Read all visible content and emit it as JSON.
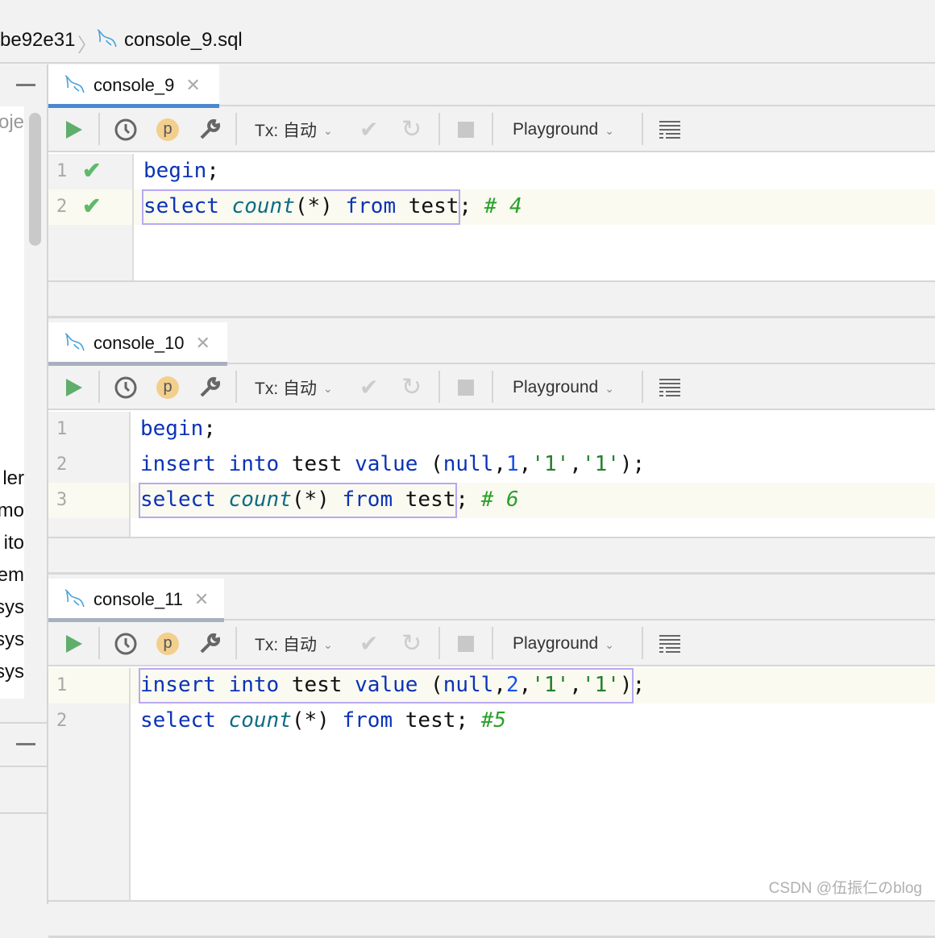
{
  "breadcrumb": {
    "parent": "be92e31",
    "file": "console_9.sql"
  },
  "left_panel": {
    "items": [
      "oje",
      "ler",
      "mo",
      "ito",
      "em",
      "sys",
      "sys",
      "sys"
    ]
  },
  "toolbar": {
    "tx_label": "Tx: 自动",
    "schema_label": "Playground"
  },
  "consoles": [
    {
      "tab": "console_9",
      "active": true,
      "lines": [
        {
          "n": "1",
          "ok": true,
          "hl": false,
          "tokens": [
            [
              "kw",
              "begin"
            ],
            [
              "",
              "; "
            ]
          ]
        },
        {
          "n": "2",
          "ok": true,
          "hl": true,
          "tokens": [
            [
              "kw",
              "select "
            ],
            [
              "fn",
              "count"
            ],
            [
              "",
              "(*) "
            ],
            [
              "kw",
              "from"
            ],
            [
              "",
              " test"
            ],
            [
              "",
              "; "
            ],
            [
              "cm",
              "# 4"
            ]
          ]
        }
      ]
    },
    {
      "tab": "console_10",
      "active": false,
      "lines": [
        {
          "n": "1",
          "ok": false,
          "hl": false,
          "tokens": [
            [
              "kw",
              "begin"
            ],
            [
              "",
              ";"
            ]
          ]
        },
        {
          "n": "2",
          "ok": false,
          "hl": false,
          "tokens": [
            [
              "kw",
              "insert into "
            ],
            [
              "",
              "test "
            ],
            [
              "kw",
              "value"
            ],
            [
              "",
              " ("
            ],
            [
              "kw",
              "null"
            ],
            [
              "",
              ","
            ],
            [
              "num",
              "1"
            ],
            [
              "",
              ","
            ],
            [
              "str",
              "'1'"
            ],
            [
              "",
              ","
            ],
            [
              "str",
              "'1'"
            ],
            [
              "",
              ");"
            ]
          ]
        },
        {
          "n": "3",
          "ok": false,
          "hl": true,
          "tokens": [
            [
              "kw",
              "select "
            ],
            [
              "fn",
              "count"
            ],
            [
              "",
              "(*) "
            ],
            [
              "kw",
              "from"
            ],
            [
              "",
              " test"
            ],
            [
              "",
              "; "
            ],
            [
              "cm",
              "# 6"
            ]
          ]
        }
      ]
    },
    {
      "tab": "console_11",
      "active": false,
      "lines": [
        {
          "n": "1",
          "ok": false,
          "hl": true,
          "tokens": [
            [
              "kw",
              "insert into "
            ],
            [
              "",
              "test "
            ],
            [
              "kw",
              "value"
            ],
            [
              "",
              " ("
            ],
            [
              "kw",
              "null"
            ],
            [
              "",
              ","
            ],
            [
              "num",
              "2"
            ],
            [
              "",
              ","
            ],
            [
              "str",
              "'1'"
            ],
            [
              "",
              ","
            ],
            [
              "str",
              "'1'"
            ],
            [
              "",
              ")"
            ],
            [
              "",
              ";"
            ]
          ]
        },
        {
          "n": "2",
          "ok": false,
          "hl": false,
          "tokens": [
            [
              "kw",
              "select "
            ],
            [
              "fn",
              "count"
            ],
            [
              "",
              "(*) "
            ],
            [
              "kw",
              "from"
            ],
            [
              "",
              " test"
            ],
            [
              "",
              "; "
            ],
            [
              "cm",
              "#5"
            ]
          ]
        }
      ]
    }
  ],
  "watermark": "CSDN @伍振仁のblog",
  "colors": {
    "active_tab": "#4a88d0",
    "inactive_tab": "#a8b0c0",
    "run": "#5fae6b",
    "keyword": "#0b33b5"
  }
}
